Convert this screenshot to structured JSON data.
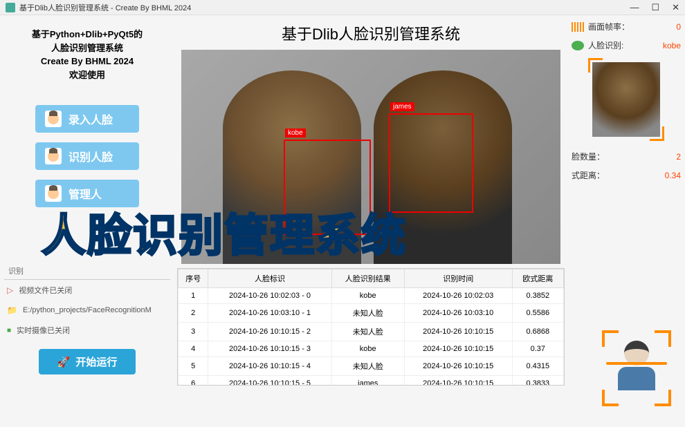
{
  "window": {
    "title": "基于Dlib人脸识别管理系统 - Create By BHML 2024"
  },
  "header": {
    "main_title": "基于Dlib人脸识别管理系统"
  },
  "info": {
    "line1": "基于Python+Dlib+PyQt5的",
    "line2": "人脸识别管理系统",
    "line3": "Create By BHML 2024",
    "line4": "欢迎使用"
  },
  "sidebar": {
    "btn_enter": "录入人脸",
    "btn_recognize": "识别人脸",
    "btn_manage": "管理人"
  },
  "identify": {
    "tab": "识别",
    "video_closed": "视频文件已关闭",
    "path": "E:/python_projects/FaceRecognitionM",
    "camera_closed": "实时摄像已关闭",
    "run": "开始运行"
  },
  "detections": {
    "label1": "kobe",
    "label2": "james"
  },
  "overlay": "人脸识别管理系统",
  "stats": {
    "fps_label": "画面帧率：",
    "fps_val": "0",
    "rec_label": "人脸识别:",
    "rec_val": "kobe",
    "count_label": "脸数量：",
    "count_val": "2",
    "dist_label": "式距离：",
    "dist_val": "0.34"
  },
  "table": {
    "headers": [
      "序号",
      "人脸标识",
      "人脸识别结果",
      "识别时间",
      "欧式距离"
    ],
    "rows": [
      [
        "1",
        "2024-10-26 10:02:03 - 0",
        "kobe",
        "2024-10-26 10:02:03",
        "0.3852"
      ],
      [
        "2",
        "2024-10-26 10:03:10 - 1",
        "未知人脸",
        "2024-10-26 10:03:10",
        "0.5586"
      ],
      [
        "3",
        "2024-10-26 10:10:15 - 2",
        "未知人脸",
        "2024-10-26 10:10:15",
        "0.6868"
      ],
      [
        "4",
        "2024-10-26 10:10:15 - 3",
        "kobe",
        "2024-10-26 10:10:15",
        "0.37"
      ],
      [
        "5",
        "2024-10-26 10:10:15 - 4",
        "未知人脸",
        "2024-10-26 10:10:15",
        "0.4315"
      ],
      [
        "6",
        "2024-10-26 10:10:15 - 5",
        "james",
        "2024-10-26 10:10:15",
        "0.3833"
      ]
    ]
  }
}
